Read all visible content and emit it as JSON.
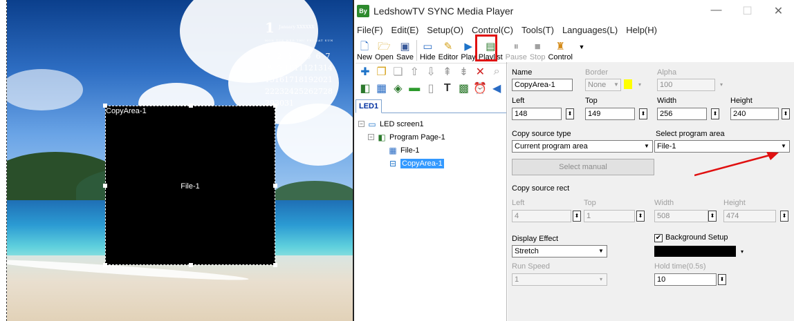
{
  "preview": {
    "copyarea_label": "CopyArea-1",
    "file_label": "File-1",
    "calendar": {
      "month": "1",
      "month_title": "January XXXXXX",
      "weekdays": "MON TUE WED THU FRI SAT SUN",
      "days": [
        "1",
        "2",
        "3",
        "4",
        "5",
        "6",
        "7",
        "8",
        "9",
        "10",
        "11",
        "12",
        "13",
        "14",
        "15",
        "16",
        "17",
        "18",
        "19",
        "20",
        "21",
        "22",
        "23",
        "24",
        "25",
        "26",
        "27",
        "28",
        "29",
        "30",
        "31"
      ]
    }
  },
  "window": {
    "title": "LedshowTV SYNC Media Player",
    "logo": "By",
    "minimize": "—",
    "maximize": "☐",
    "close": "✕"
  },
  "menu": [
    "File(F)",
    "Edit(E)",
    "Setup(O)",
    "Control(C)",
    "Tools(T)",
    "Languages(L)",
    "Help(H)"
  ],
  "toolbar": {
    "new": "New",
    "open": "Open",
    "save": "Save",
    "hide": "Hide",
    "editor": "Editor",
    "play": "Play",
    "playlist": "Playlist",
    "pause": "Pause",
    "stop": "Stop",
    "control": "Control",
    "more": "▼"
  },
  "tree": {
    "tab": "LED1",
    "screen": "LED screen1",
    "page": "Program Page-1",
    "file": "File-1",
    "copyarea": "CopyArea-1"
  },
  "props": {
    "name_label": "Name",
    "name_value": "CopyArea-1",
    "border_label": "Border",
    "border_value": "None",
    "alpha_label": "Alpha",
    "alpha_value": "100",
    "left_label": "Left",
    "left_value": "148",
    "top_label": "Top",
    "top_value": "149",
    "width_label": "Width",
    "width_value": "256",
    "height_label": "Height",
    "height_value": "240",
    "copy_source_type_label": "Copy source type",
    "copy_source_type_value": "Current program area",
    "select_program_area_label": "Select program area",
    "select_program_area_value": "File-1",
    "select_manual_button": "Select manual",
    "copy_source_rect_label": "Copy source rect",
    "rect_left_label": "Left",
    "rect_left_value": "4",
    "rect_top_label": "Top",
    "rect_top_value": "1",
    "rect_width_label": "Width",
    "rect_width_value": "508",
    "rect_height_label": "Height",
    "rect_height_value": "474",
    "display_effect_label": "Display Effect",
    "display_effect_value": "Stretch",
    "background_setup_label": "Background Setup",
    "background_setup_checked": "✔",
    "background_color": "#000000",
    "run_speed_label": "Run Speed",
    "run_speed_value": "1",
    "hold_time_label": "Hold time(0.5s)",
    "hold_time_value": "10"
  },
  "colors": {
    "highlight": "#e01010",
    "selection": "#3399ff",
    "border_swatch": "#ffff00"
  }
}
